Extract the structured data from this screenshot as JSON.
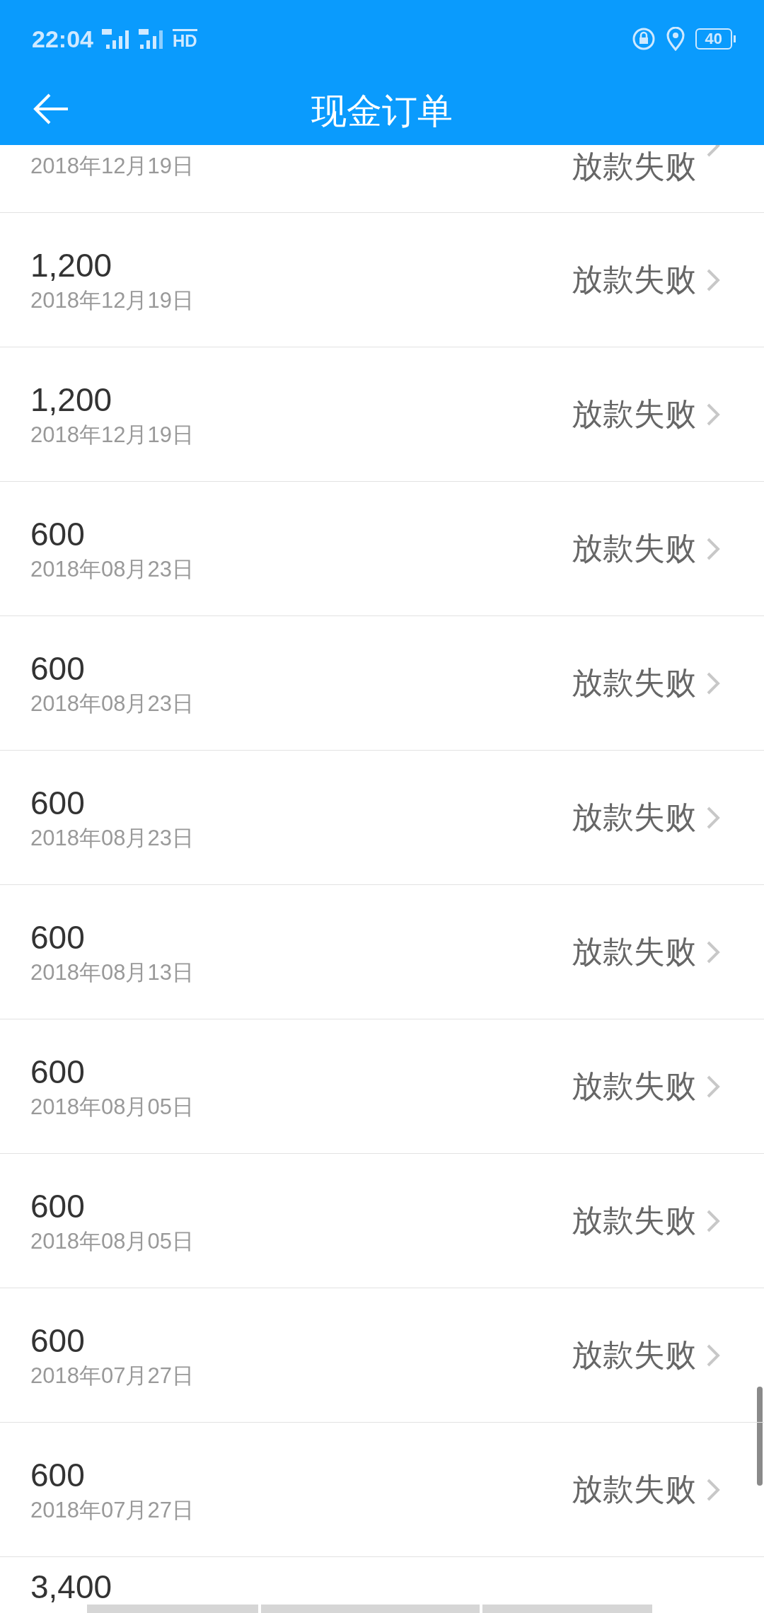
{
  "status_bar": {
    "time": "22:04",
    "hd": "HD",
    "battery": "40"
  },
  "header": {
    "title": "现金订单"
  },
  "orders": [
    {
      "date": "2018年12月19日",
      "status": "放款失败"
    },
    {
      "amount": "1,200",
      "date": "2018年12月19日",
      "status": "放款失败"
    },
    {
      "amount": "1,200",
      "date": "2018年12月19日",
      "status": "放款失败"
    },
    {
      "amount": "600",
      "date": "2018年08月23日",
      "status": "放款失败"
    },
    {
      "amount": "600",
      "date": "2018年08月23日",
      "status": "放款失败"
    },
    {
      "amount": "600",
      "date": "2018年08月23日",
      "status": "放款失败"
    },
    {
      "amount": "600",
      "date": "2018年08月13日",
      "status": "放款失败"
    },
    {
      "amount": "600",
      "date": "2018年08月05日",
      "status": "放款失败"
    },
    {
      "amount": "600",
      "date": "2018年08月05日",
      "status": "放款失败"
    },
    {
      "amount": "600",
      "date": "2018年07月27日",
      "status": "放款失败"
    },
    {
      "amount": "600",
      "date": "2018年07月27日",
      "status": "放款失败"
    },
    {
      "amount": "3,400"
    }
  ]
}
